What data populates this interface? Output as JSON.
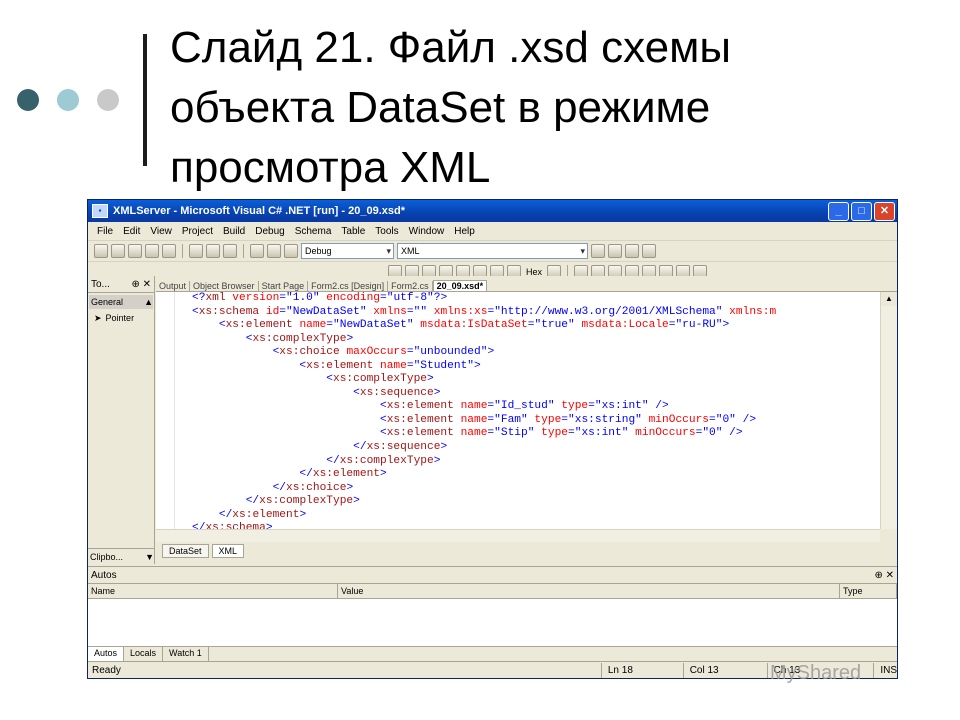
{
  "slide": {
    "title": "Слайд 21. Файл .xsd схемы\nобъекта DataSet в режиме\nпросмотра XML",
    "watermark": "MyShared"
  },
  "window": {
    "title": "XMLServer - Microsoft Visual C# .NET [run] - 20_09.xsd*",
    "controls": {
      "minimize": "_",
      "maximize": "□",
      "close": "✕"
    }
  },
  "menu": [
    "File",
    "Edit",
    "View",
    "Project",
    "Build",
    "Debug",
    "Schema",
    "Table",
    "Tools",
    "Window",
    "Help"
  ],
  "toolbar": {
    "config_combo": "Debug",
    "platform_combo": "XML",
    "hex_label": "Hex"
  },
  "toolbox": {
    "header": "To...",
    "pin": "⊕",
    "close": "✕",
    "general": "General",
    "pointer": "Pointer",
    "clipboard": "Clipbo..."
  },
  "doc_tabs": [
    "Output",
    "Object Browser",
    "Start Page",
    "Form2.cs [Design]",
    "Form2.cs",
    "20_09.xsd*"
  ],
  "code_lines": [
    {
      "indent": "",
      "parts": [
        [
          "p",
          "<?"
        ],
        [
          "t",
          "xml "
        ],
        [
          "a",
          "version"
        ],
        [
          "p",
          "="
        ],
        [
          "v",
          "\"1.0\""
        ],
        [
          "a",
          " encoding"
        ],
        [
          "p",
          "="
        ],
        [
          "v",
          "\"utf-8\""
        ],
        [
          "p",
          "?>"
        ]
      ]
    },
    {
      "indent": "",
      "parts": [
        [
          "p",
          "<"
        ],
        [
          "t",
          "xs:schema "
        ],
        [
          "a",
          "id"
        ],
        [
          "p",
          "="
        ],
        [
          "v",
          "\"NewDataSet\""
        ],
        [
          "a",
          " xmlns"
        ],
        [
          "p",
          "="
        ],
        [
          "v",
          "\"\""
        ],
        [
          "a",
          " xmlns:xs"
        ],
        [
          "p",
          "="
        ],
        [
          "v",
          "\"http://www.w3.org/2001/XMLSchema\""
        ],
        [
          "a",
          " xmlns:m"
        ]
      ]
    },
    {
      "indent": "    ",
      "parts": [
        [
          "p",
          "<"
        ],
        [
          "t",
          "xs:element "
        ],
        [
          "a",
          "name"
        ],
        [
          "p",
          "="
        ],
        [
          "v",
          "\"NewDataSet\""
        ],
        [
          "a",
          " msdata:IsDataSet"
        ],
        [
          "p",
          "="
        ],
        [
          "v",
          "\"true\""
        ],
        [
          "a",
          " msdata:Locale"
        ],
        [
          "p",
          "="
        ],
        [
          "v",
          "\"ru-RU\""
        ],
        [
          "p",
          ">"
        ]
      ]
    },
    {
      "indent": "        ",
      "parts": [
        [
          "p",
          "<"
        ],
        [
          "t",
          "xs:complexType"
        ],
        [
          "p",
          ">"
        ]
      ]
    },
    {
      "indent": "            ",
      "parts": [
        [
          "p",
          "<"
        ],
        [
          "t",
          "xs:choice "
        ],
        [
          "a",
          "maxOccurs"
        ],
        [
          "p",
          "="
        ],
        [
          "v",
          "\"unbounded\""
        ],
        [
          "p",
          ">"
        ]
      ]
    },
    {
      "indent": "                ",
      "parts": [
        [
          "p",
          "<"
        ],
        [
          "t",
          "xs:element "
        ],
        [
          "a",
          "name"
        ],
        [
          "p",
          "="
        ],
        [
          "v",
          "\"Student\""
        ],
        [
          "p",
          ">"
        ]
      ]
    },
    {
      "indent": "                    ",
      "parts": [
        [
          "p",
          "<"
        ],
        [
          "t",
          "xs:complexType"
        ],
        [
          "p",
          ">"
        ]
      ]
    },
    {
      "indent": "                        ",
      "parts": [
        [
          "p",
          "<"
        ],
        [
          "t",
          "xs:sequence"
        ],
        [
          "p",
          ">"
        ]
      ]
    },
    {
      "indent": "                            ",
      "parts": [
        [
          "p",
          "<"
        ],
        [
          "t",
          "xs:element "
        ],
        [
          "a",
          "name"
        ],
        [
          "p",
          "="
        ],
        [
          "v",
          "\"Id_stud\""
        ],
        [
          "a",
          " type"
        ],
        [
          "p",
          "="
        ],
        [
          "v",
          "\"xs:int\""
        ],
        [
          "p",
          " />"
        ]
      ]
    },
    {
      "indent": "                            ",
      "parts": [
        [
          "p",
          "<"
        ],
        [
          "t",
          "xs:element "
        ],
        [
          "a",
          "name"
        ],
        [
          "p",
          "="
        ],
        [
          "v",
          "\"Fam\""
        ],
        [
          "a",
          " type"
        ],
        [
          "p",
          "="
        ],
        [
          "v",
          "\"xs:string\""
        ],
        [
          "a",
          " minOccurs"
        ],
        [
          "p",
          "="
        ],
        [
          "v",
          "\"0\""
        ],
        [
          "p",
          " />"
        ]
      ]
    },
    {
      "indent": "                            ",
      "parts": [
        [
          "p",
          "<"
        ],
        [
          "t",
          "xs:element "
        ],
        [
          "a",
          "name"
        ],
        [
          "p",
          "="
        ],
        [
          "v",
          "\"Stip\""
        ],
        [
          "a",
          " type"
        ],
        [
          "p",
          "="
        ],
        [
          "v",
          "\"xs:int\""
        ],
        [
          "a",
          " minOccurs"
        ],
        [
          "p",
          "="
        ],
        [
          "v",
          "\"0\""
        ],
        [
          "p",
          " />"
        ]
      ]
    },
    {
      "indent": "                        ",
      "parts": [
        [
          "p",
          "</"
        ],
        [
          "t",
          "xs:sequence"
        ],
        [
          "p",
          ">"
        ]
      ]
    },
    {
      "indent": "                    ",
      "parts": [
        [
          "p",
          "</"
        ],
        [
          "t",
          "xs:complexType"
        ],
        [
          "p",
          ">"
        ]
      ]
    },
    {
      "indent": "                ",
      "parts": [
        [
          "p",
          "</"
        ],
        [
          "t",
          "xs:element"
        ],
        [
          "p",
          ">"
        ]
      ]
    },
    {
      "indent": "            ",
      "parts": [
        [
          "p",
          "</"
        ],
        [
          "t",
          "xs:choice"
        ],
        [
          "p",
          ">"
        ]
      ]
    },
    {
      "indent": "        ",
      "parts": [
        [
          "p",
          "</"
        ],
        [
          "t",
          "xs:complexType"
        ],
        [
          "p",
          ">"
        ]
      ]
    },
    {
      "indent": "    ",
      "parts": [
        [
          "p",
          "</"
        ],
        [
          "t",
          "xs:element"
        ],
        [
          "p",
          ">"
        ]
      ]
    },
    {
      "indent": "",
      "parts": [
        [
          "p",
          "</"
        ],
        [
          "t",
          "xs:schema"
        ],
        [
          "p",
          ">"
        ]
      ]
    }
  ],
  "view_tabs": [
    "DataSet",
    "XML"
  ],
  "autos": {
    "header": "Autos",
    "pin": "⊕",
    "close": "✕",
    "columns": [
      "Name",
      "Value",
      "Type"
    ]
  },
  "bottom_tabs": [
    "Autos",
    "Locals",
    "Watch 1"
  ],
  "status": {
    "ready": "Ready",
    "line": "Ln 18",
    "col": "Col 13",
    "ch": "Ch 13",
    "ins": "INS"
  },
  "colors": {
    "title_blue": "#0842b0",
    "xml_tag": "#a31515",
    "xml_attr": "#ff0000",
    "xml_value": "#0000ff"
  }
}
